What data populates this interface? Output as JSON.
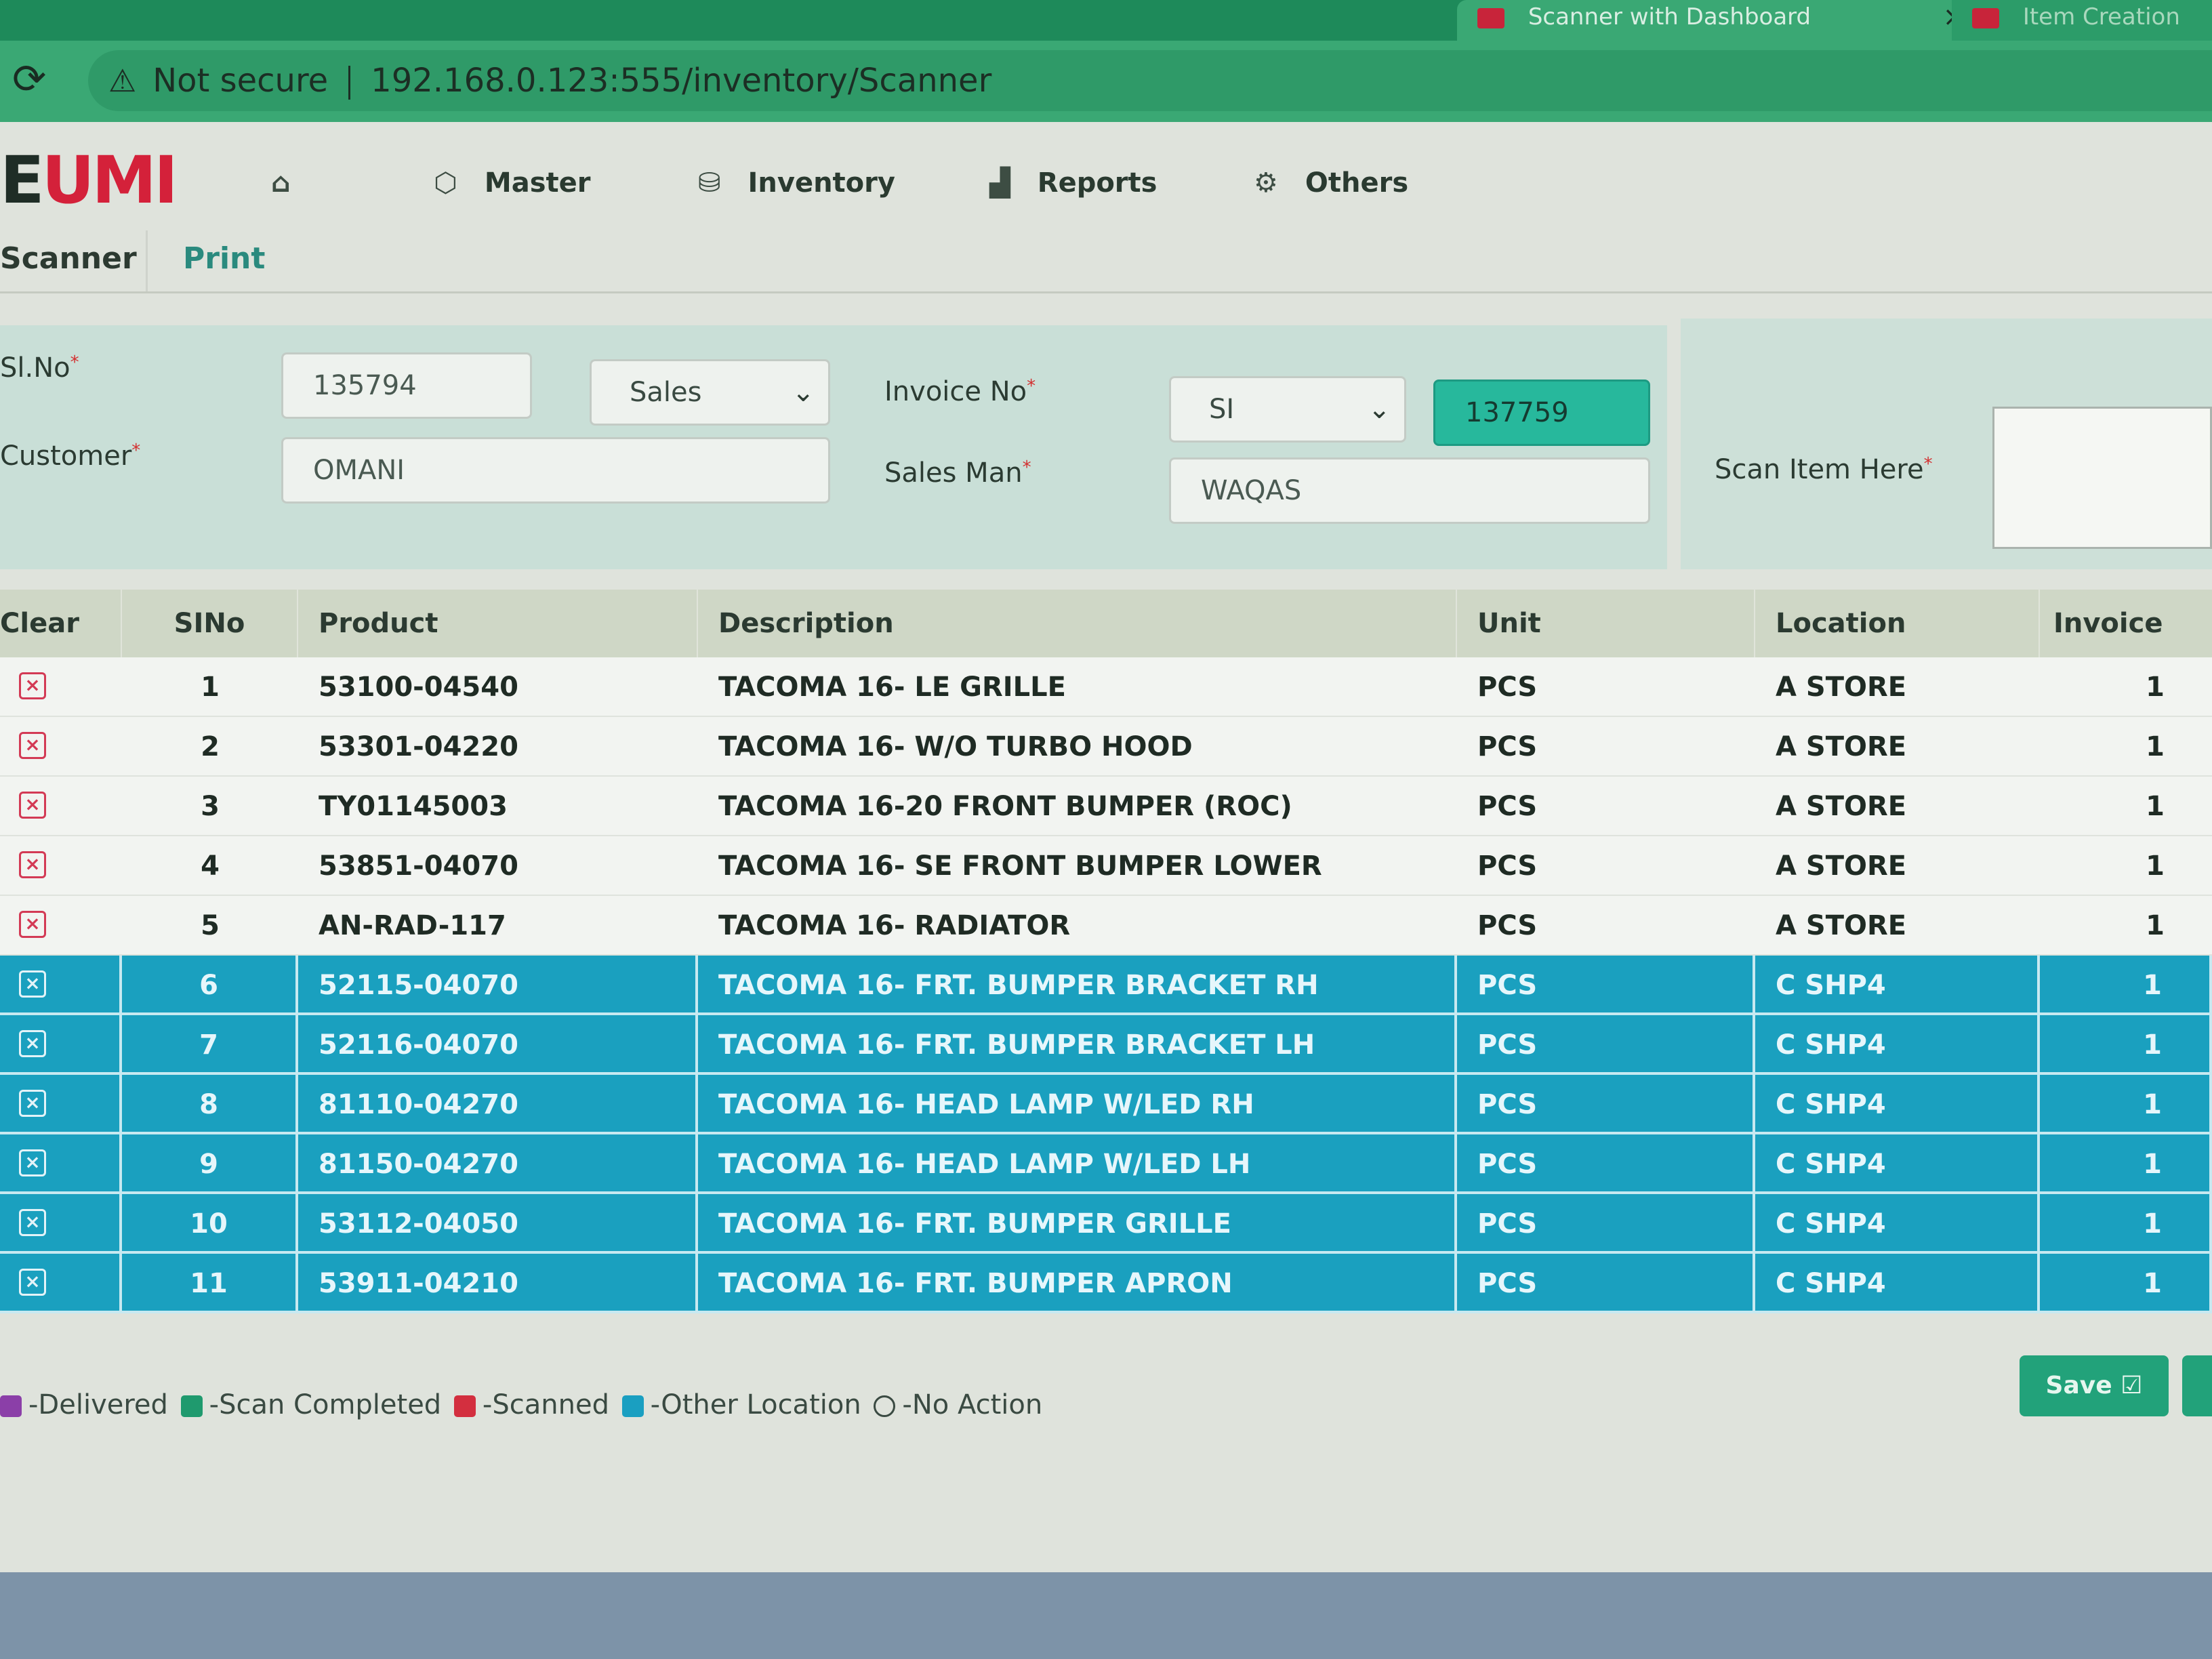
{
  "browser": {
    "active_tab_title": "Scanner with Dashboard",
    "other_tab_title": "Item Creation",
    "security_label": "Not secure",
    "url": "192.168.0.123:555/inventory/Scanner"
  },
  "app": {
    "logo_text": "EUMI",
    "nav": {
      "home_icon": "home-icon",
      "master": "Master",
      "inventory": "Inventory",
      "reports": "Reports",
      "others": "Others"
    },
    "subnav": {
      "scanner": "Scanner",
      "print": "Print"
    }
  },
  "form": {
    "sl_no_label": "Sl.No",
    "sl_no_value": "135794",
    "type_value": "Sales",
    "customer_label": "Customer",
    "customer_value": "OMANI",
    "invoice_no_label": "Invoice No",
    "invoice_prefix_value": "SI",
    "invoice_number_value": "137759",
    "sales_man_label": "Sales Man",
    "sales_man_value": "WAQAS",
    "scan_item_label": "Scan Item Here"
  },
  "table": {
    "headers": {
      "clear": "Clear",
      "sino": "SINo",
      "product": "Product",
      "description": "Description",
      "unit": "Unit",
      "location": "Location",
      "invoice_qty": "Invoice Qty"
    },
    "rows": [
      {
        "sino": "1",
        "product": "53100-04540",
        "description": "TACOMA 16- LE GRILLE",
        "unit": "PCS",
        "location": "A STORE",
        "qty": "1",
        "status": "normal"
      },
      {
        "sino": "2",
        "product": "53301-04220",
        "description": "TACOMA 16- W/O TURBO HOOD",
        "unit": "PCS",
        "location": "A STORE",
        "qty": "1",
        "status": "normal"
      },
      {
        "sino": "3",
        "product": "TY01145003",
        "description": "TACOMA 16-20 FRONT BUMPER (ROC)",
        "unit": "PCS",
        "location": "A STORE",
        "qty": "1",
        "status": "normal"
      },
      {
        "sino": "4",
        "product": "53851-04070",
        "description": "TACOMA 16- SE FRONT BUMPER LOWER",
        "unit": "PCS",
        "location": "A STORE",
        "qty": "1",
        "status": "normal"
      },
      {
        "sino": "5",
        "product": "AN-RAD-117",
        "description": "TACOMA 16- RADIATOR",
        "unit": "PCS",
        "location": "A STORE",
        "qty": "1",
        "status": "normal"
      },
      {
        "sino": "6",
        "product": "52115-04070",
        "description": "TACOMA 16- FRT. BUMPER BRACKET RH",
        "unit": "PCS",
        "location": "C SHP4",
        "qty": "1",
        "status": "other-location"
      },
      {
        "sino": "7",
        "product": "52116-04070",
        "description": "TACOMA 16- FRT. BUMPER BRACKET LH",
        "unit": "PCS",
        "location": "C SHP4",
        "qty": "1",
        "status": "other-location"
      },
      {
        "sino": "8",
        "product": "81110-04270",
        "description": "TACOMA 16- HEAD LAMP W/LED RH",
        "unit": "PCS",
        "location": "C SHP4",
        "qty": "1",
        "status": "other-location"
      },
      {
        "sino": "9",
        "product": "81150-04270",
        "description": "TACOMA 16- HEAD LAMP W/LED LH",
        "unit": "PCS",
        "location": "C SHP4",
        "qty": "1",
        "status": "other-location"
      },
      {
        "sino": "10",
        "product": "53112-04050",
        "description": "TACOMA 16- FRT. BUMPER GRILLE",
        "unit": "PCS",
        "location": "C SHP4",
        "qty": "1",
        "status": "other-location"
      },
      {
        "sino": "11",
        "product": "53911-04210",
        "description": "TACOMA 16- FRT. BUMPER APRON",
        "unit": "PCS",
        "location": "C SHP4",
        "qty": "1",
        "status": "other-location"
      }
    ]
  },
  "legend": {
    "delivered": "-Delivered",
    "scan_completed": "-Scan Completed",
    "scanned": "-Scanned",
    "other_location": "-Other Location",
    "no_action": "-No Action",
    "colors": {
      "delivered": "#8b3fa8",
      "scan_completed": "#1f9a6e",
      "scanned": "#d32f3f",
      "other_location": "#1a9fc1"
    }
  },
  "actions": {
    "save_label": "Save"
  },
  "colors": {
    "header_green": "#3aa874",
    "row_other_location": "#1aa0bf",
    "accent_teal": "#27b89c"
  }
}
